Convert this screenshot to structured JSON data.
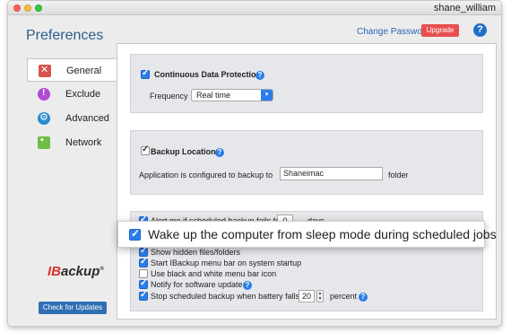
{
  "window": {
    "username": "shane_william"
  },
  "header": {
    "title": "Preferences",
    "change_password": "Change Password",
    "upgrade": "Upgrade",
    "help": "?"
  },
  "sidebar": {
    "items": [
      {
        "label": "General",
        "icon": "wrench-icon",
        "selected": true
      },
      {
        "label": "Exclude",
        "icon": "exclude-icon",
        "selected": false
      },
      {
        "label": "Advanced",
        "icon": "gear-icon",
        "selected": false
      },
      {
        "label": "Network",
        "icon": "network-icon",
        "selected": false
      }
    ]
  },
  "general": {
    "cdp": {
      "label": "Continuous Data Protection",
      "checked": true,
      "frequency_label": "Frequency",
      "frequency_value": "Real time"
    },
    "backup_location": {
      "label": "Backup Location",
      "checked": true,
      "configured_label": "Application is configured to backup to",
      "folder_value": "Shaneimac",
      "folder_suffix": "folder"
    },
    "alert": {
      "label": "Alert me if scheduled backup fails for",
      "days_value": "0",
      "days_suffix": "days",
      "checked": true
    },
    "wake": {
      "label": "Wake up the computer from sleep mode during scheduled jobs",
      "checked": true
    },
    "options": [
      {
        "label": "Show hidden files/folders",
        "checked": true
      },
      {
        "label": "Start IBackup menu bar on system startup",
        "checked": true
      },
      {
        "label": "Use black and white menu bar icon",
        "checked": false
      },
      {
        "label": "Notify for software update",
        "checked": true
      }
    ],
    "battery": {
      "label": "Stop scheduled backup when battery falls to",
      "value": "20",
      "suffix": "percent",
      "checked": true
    }
  },
  "footer": {
    "logo_ib": "IB",
    "logo_rest": "ackup",
    "logo_mark": "®",
    "check_updates": "Check for Updates"
  }
}
